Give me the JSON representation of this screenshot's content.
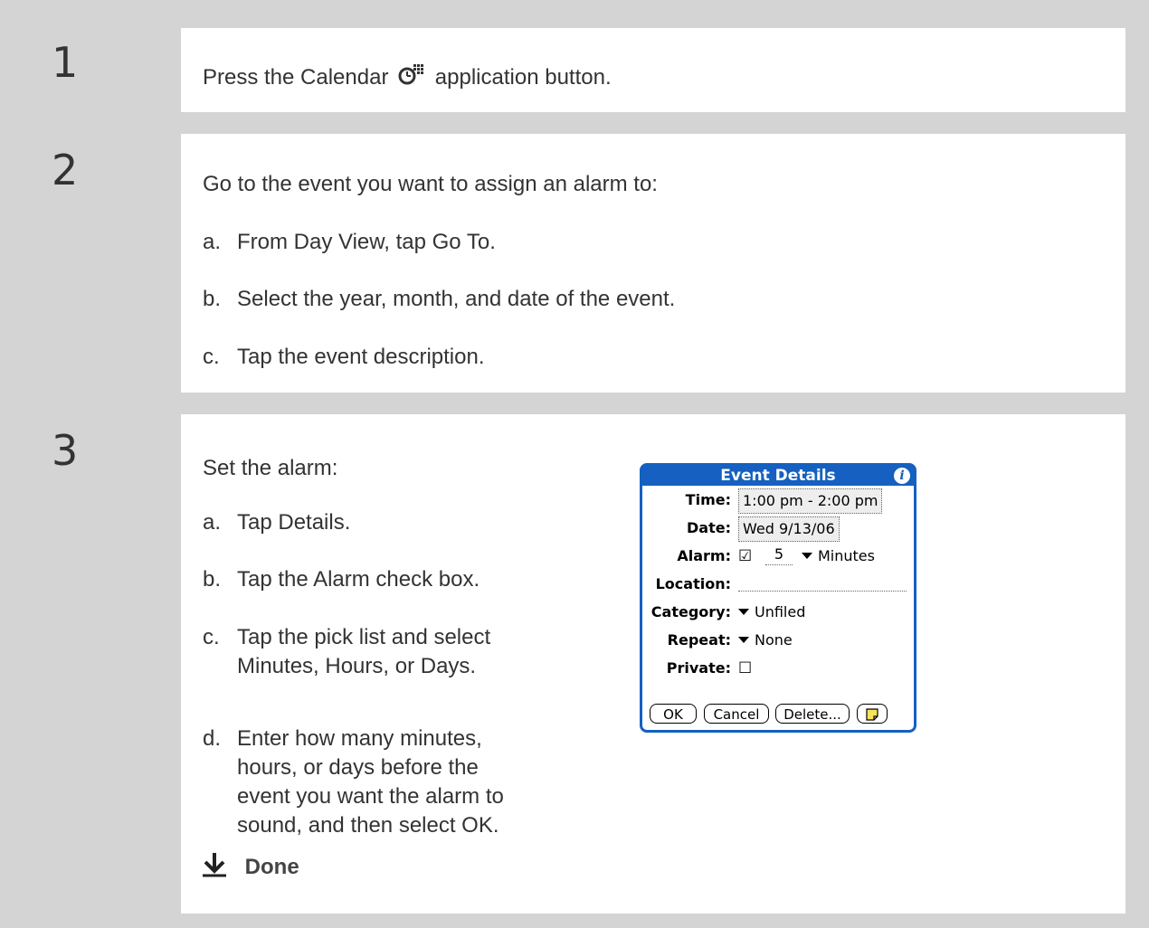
{
  "steps": [
    {
      "number": "1",
      "text_before": "Press the Calendar",
      "icon": "calendar-app-icon",
      "text_after": "application button."
    },
    {
      "number": "2",
      "intro": "Go to the event you want to assign an alarm to:",
      "items": [
        {
          "marker": "a.",
          "text": "From Day View, tap Go To."
        },
        {
          "marker": "b.",
          "text": "Select the year, month, and date of the event."
        },
        {
          "marker": "c.",
          "text": "Tap the event description."
        }
      ]
    },
    {
      "number": "3",
      "intro": "Set the alarm:",
      "items": [
        {
          "marker": "a.",
          "lines": [
            "Tap Details."
          ]
        },
        {
          "marker": "b.",
          "lines": [
            "Tap the Alarm check box."
          ]
        },
        {
          "marker": "c.",
          "lines": [
            "Tap the pick list and select",
            "Minutes, Hours, or Days."
          ]
        },
        {
          "marker": "d.",
          "lines": [
            "Enter how many minutes,",
            "hours, or days before the",
            "event you want the alarm to",
            "sound, and then select OK."
          ]
        }
      ],
      "done_label": "Done"
    }
  ],
  "dialog": {
    "title": "Event Details",
    "time_label": "Time:",
    "time_value": "1:00 pm - 2:00 pm",
    "date_label": "Date:",
    "date_value": "Wed 9/13/06",
    "alarm_label": "Alarm:",
    "alarm_checkbox": "☑",
    "alarm_amount": "5",
    "alarm_unit": "Minutes",
    "location_label": "Location:",
    "category_label": "Category:",
    "category_value": "Unfiled",
    "repeat_label": "Repeat:",
    "repeat_value": "None",
    "private_label": "Private:",
    "private_checkbox": "☐",
    "buttons": [
      "OK",
      "Cancel",
      "Delete..."
    ],
    "note_icon": "note-icon"
  },
  "colors": {
    "background": "#d4d4d4",
    "dialog_accent": "#1560c0"
  }
}
